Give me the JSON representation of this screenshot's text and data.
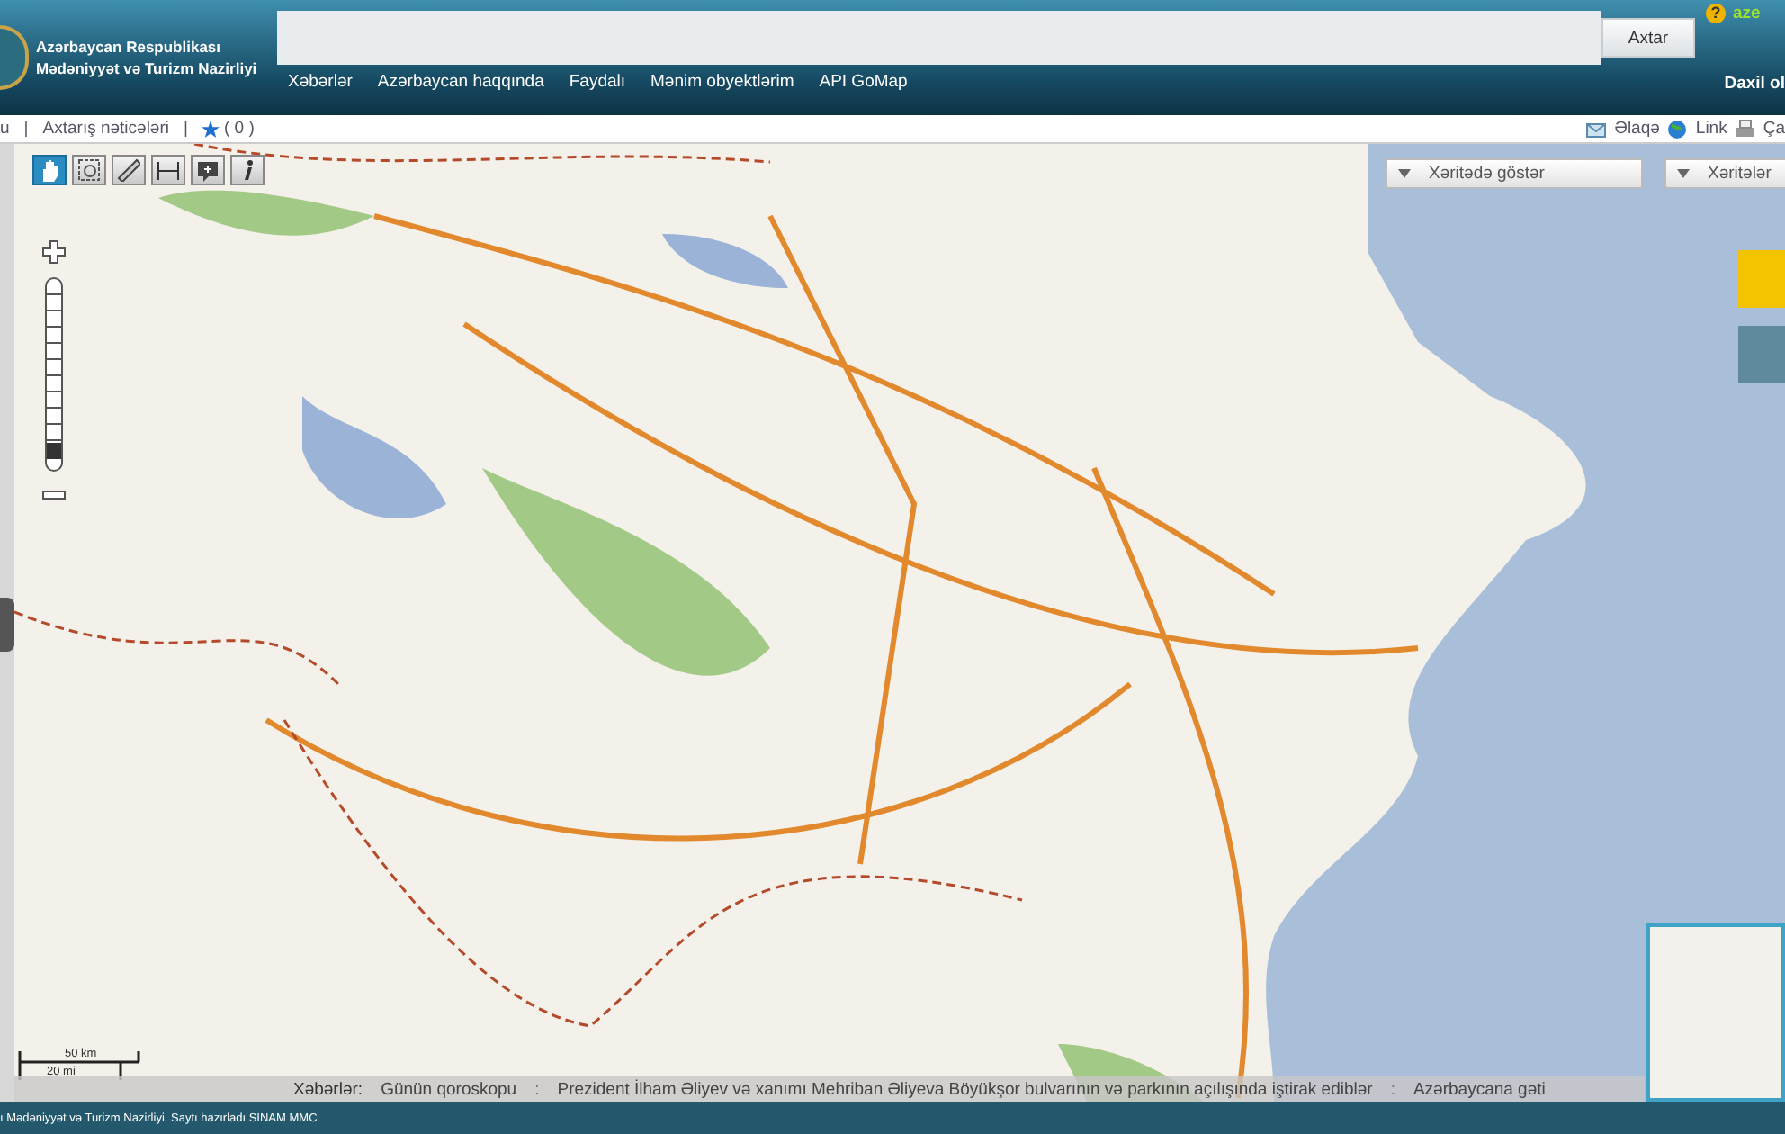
{
  "header": {
    "org_line1": "Azərbaycan Respublikası",
    "org_line2": "Mədəniyyət və Turizm Nazirliyi",
    "help": "?",
    "search_button": "Axtar",
    "language": "aze",
    "nav": [
      "Xəbərlər",
      "Azərbaycan haqqında",
      "Faydalı",
      "Mənim obyektlərim",
      "API GoMap"
    ],
    "login": "Daxil ol"
  },
  "subbar": {
    "left": [
      {
        "kind": "text",
        "text": "u"
      },
      {
        "kind": "sep",
        "text": "|"
      },
      {
        "kind": "link",
        "text": "Axtarış nəticələri"
      },
      {
        "kind": "sep",
        "text": "|"
      },
      {
        "kind": "fav",
        "text": "( 0 )"
      }
    ],
    "right": [
      {
        "kind": "contact",
        "text": "Əlaqə"
      },
      {
        "kind": "link",
        "text": "Link"
      },
      {
        "kind": "print",
        "text": "Ça"
      }
    ]
  },
  "map": {
    "tools": [
      {
        "kind": "hand",
        "selected": true
      },
      {
        "kind": "zoombox",
        "selected": false
      },
      {
        "kind": "ruler",
        "selected": false
      },
      {
        "kind": "area",
        "selected": false
      },
      {
        "kind": "marker",
        "selected": false
      },
      {
        "kind": "info",
        "selected": false
      }
    ],
    "zoom": {
      "level": 0.06
    },
    "dropdowns": [
      "Xəritədə göstər",
      "Xəritələr"
    ],
    "scale": [
      "50 km",
      "20 mi"
    ],
    "ticker": [
      {
        "kind": "label",
        "text": "Xəbərlər:"
      },
      {
        "kind": "item",
        "text": "Günün qoroskopu"
      },
      {
        "kind": "sep",
        "text": ":"
      },
      {
        "kind": "item",
        "text": "Prezident İlham Əliyev və xanımı Mehriban Əliyeva Böyükşor bulvarının və parkının açılışında iştirak ediblər"
      },
      {
        "kind": "sep",
        "text": ":"
      },
      {
        "kind": "item",
        "text": "Azərbaycana gəti"
      }
    ]
  },
  "footer": "ı Mədəniyyət və Turizm Nazirliyi. Saytı hazırladı SINAM MMC"
}
